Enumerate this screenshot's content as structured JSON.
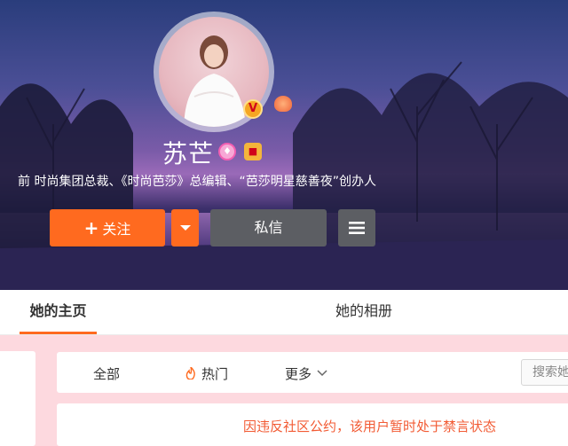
{
  "profile": {
    "name": "苏芒",
    "description": "前 时尚集团总裁、《时尚芭莎》总编辑、“芭莎明星慈善夜”创办人",
    "verified_badge": "V",
    "icons": [
      "verified-v-icon",
      "pink-badge-icon",
      "gift-badge-icon"
    ]
  },
  "actions": {
    "follow_plus": "+",
    "follow_label": "关注",
    "message_label": "私信"
  },
  "tabs": [
    {
      "label": "她的主页",
      "active": true
    },
    {
      "label": "她的相册",
      "active": false
    }
  ],
  "filters": {
    "all": "全部",
    "hot": "热门",
    "more": "更多"
  },
  "search": {
    "placeholder": "搜索她"
  },
  "notice": "因违反社区公约，该用户暂时处于禁言状态",
  "colors": {
    "accent": "#ff6a1f",
    "notice": "#f25b34",
    "page_bg": "#fdd9df",
    "dark_button": "#5c5e63"
  }
}
